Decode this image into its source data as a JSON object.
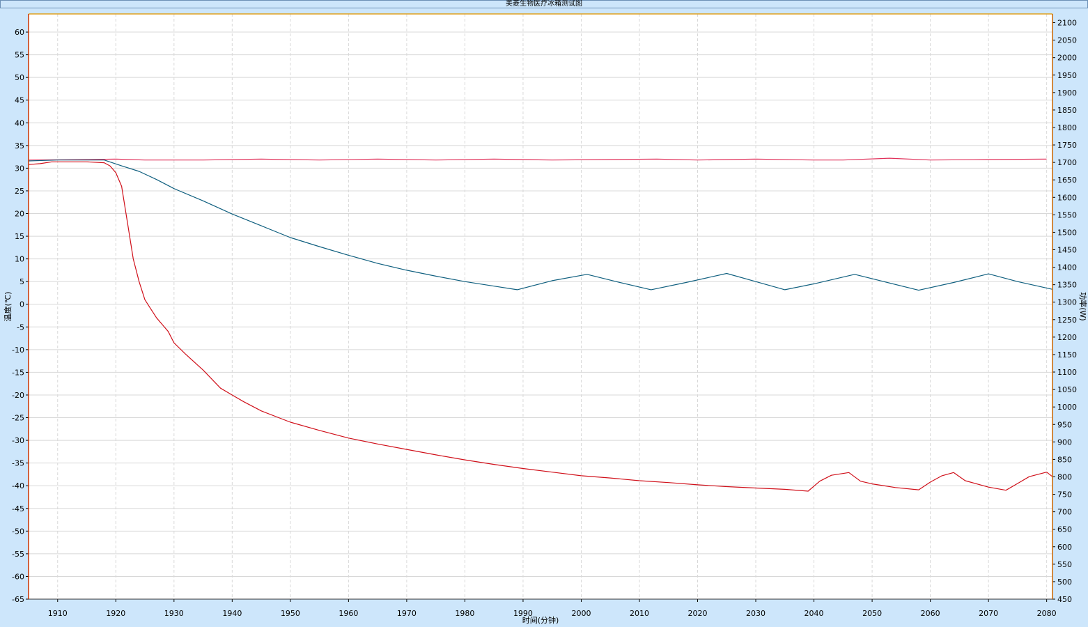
{
  "window": {
    "title": "美菱生物医疗冰箱测试图"
  },
  "colors": {
    "background": "#cde6fb",
    "plot_background": "#ffffff",
    "grid": "#d8d8d8",
    "axis_left": "#cc3300",
    "axis_right": "#cc6600",
    "top_border": "#e0a020"
  },
  "chart_data": {
    "type": "line",
    "title": "美菱生物医疗冰箱测试图",
    "xlabel": "时间(分钟)",
    "ylabel": "温度(℃)",
    "y2label": "功率(W)",
    "xlim": [
      1905,
      2081
    ],
    "ylim": [
      -65,
      64
    ],
    "y2lim": [
      450,
      2125
    ],
    "grid": true,
    "x_ticks": [
      1910,
      1920,
      1930,
      1940,
      1950,
      1960,
      1970,
      1980,
      1990,
      2000,
      2010,
      2020,
      2030,
      2040,
      2050,
      2060,
      2070,
      2080
    ],
    "y_ticks": [
      60,
      55,
      50,
      45,
      40,
      35,
      30,
      25,
      20,
      15,
      10,
      5,
      0,
      -5,
      -10,
      -15,
      -20,
      -25,
      -30,
      -35,
      -40,
      -45,
      -50,
      -55,
      -60,
      -65
    ],
    "y2_ticks": [
      2100,
      2050,
      2000,
      1950,
      1900,
      1850,
      1800,
      1750,
      1700,
      1650,
      1600,
      1550,
      1500,
      1450,
      1400,
      1350,
      1300,
      1250,
      1200,
      1150,
      1100,
      1050,
      1000,
      950,
      900,
      850,
      800,
      750,
      700,
      650,
      600,
      550,
      500,
      450
    ],
    "series": [
      {
        "color": "#e0305a",
        "points": [
          [
            1905,
            31.8
          ],
          [
            1915,
            31.9
          ],
          [
            1920,
            32.0
          ],
          [
            1925,
            31.8
          ],
          [
            1935,
            31.8
          ],
          [
            1945,
            32.0
          ],
          [
            1955,
            31.8
          ],
          [
            1965,
            32.0
          ],
          [
            1975,
            31.8
          ],
          [
            1985,
            32.0
          ],
          [
            1995,
            31.8
          ],
          [
            2005,
            31.9
          ],
          [
            2013,
            32.0
          ],
          [
            2020,
            31.8
          ],
          [
            2030,
            32.0
          ],
          [
            2040,
            31.8
          ],
          [
            2045,
            31.8
          ],
          [
            2053,
            32.2
          ],
          [
            2060,
            31.8
          ],
          [
            2070,
            31.9
          ],
          [
            2080,
            32.0
          ]
        ]
      },
      {
        "color": "#0f5f7f",
        "points": [
          [
            1905,
            31.6
          ],
          [
            1910,
            31.8
          ],
          [
            1918,
            31.8
          ],
          [
            1921,
            30.5
          ],
          [
            1924,
            29.3
          ],
          [
            1927,
            27.5
          ],
          [
            1930,
            25.5
          ],
          [
            1935,
            22.8
          ],
          [
            1940,
            19.9
          ],
          [
            1945,
            17.3
          ],
          [
            1950,
            14.7
          ],
          [
            1955,
            12.7
          ],
          [
            1960,
            10.8
          ],
          [
            1965,
            9.0
          ],
          [
            1970,
            7.5
          ],
          [
            1975,
            6.2
          ],
          [
            1980,
            5.0
          ],
          [
            1985,
            4.0
          ],
          [
            1989,
            3.2
          ],
          [
            1995,
            5.2
          ],
          [
            2001,
            6.6
          ],
          [
            2006,
            5.0
          ],
          [
            2012,
            3.2
          ],
          [
            2018,
            4.8
          ],
          [
            2025,
            6.8
          ],
          [
            2030,
            5.0
          ],
          [
            2035,
            3.2
          ],
          [
            2040,
            4.5
          ],
          [
            2047,
            6.6
          ],
          [
            2052,
            5.0
          ],
          [
            2058,
            3.1
          ],
          [
            2064,
            4.8
          ],
          [
            2070,
            6.7
          ],
          [
            2075,
            5.0
          ],
          [
            2081,
            3.3
          ]
        ]
      },
      {
        "color": "#d0101a",
        "points": [
          [
            1905,
            30.8
          ],
          [
            1907,
            31.0
          ],
          [
            1909,
            31.4
          ],
          [
            1915,
            31.4
          ],
          [
            1918,
            31.2
          ],
          [
            1919,
            30.5
          ],
          [
            1920,
            29.0
          ],
          [
            1921,
            26.0
          ],
          [
            1922,
            18.0
          ],
          [
            1923,
            10.0
          ],
          [
            1924,
            5.0
          ],
          [
            1925,
            1.0
          ],
          [
            1926,
            -1.0
          ],
          [
            1927,
            -3.0
          ],
          [
            1928,
            -4.5
          ],
          [
            1929,
            -6.0
          ],
          [
            1930,
            -8.5
          ],
          [
            1932,
            -11.0
          ],
          [
            1935,
            -14.5
          ],
          [
            1938,
            -18.5
          ],
          [
            1940,
            -20.0
          ],
          [
            1942,
            -21.5
          ],
          [
            1945,
            -23.5
          ],
          [
            1950,
            -26.0
          ],
          [
            1955,
            -27.8
          ],
          [
            1960,
            -29.5
          ],
          [
            1965,
            -30.8
          ],
          [
            1970,
            -32.0
          ],
          [
            1975,
            -33.2
          ],
          [
            1980,
            -34.3
          ],
          [
            1985,
            -35.3
          ],
          [
            1990,
            -36.2
          ],
          [
            1995,
            -37.0
          ],
          [
            2000,
            -37.8
          ],
          [
            2005,
            -38.3
          ],
          [
            2010,
            -38.9
          ],
          [
            2015,
            -39.3
          ],
          [
            2020,
            -39.8
          ],
          [
            2025,
            -40.2
          ],
          [
            2030,
            -40.5
          ],
          [
            2035,
            -40.8
          ],
          [
            2039,
            -41.2
          ],
          [
            2041,
            -39.0
          ],
          [
            2043,
            -37.7
          ],
          [
            2046,
            -37.1
          ],
          [
            2048,
            -39.0
          ],
          [
            2050,
            -39.6
          ],
          [
            2054,
            -40.4
          ],
          [
            2058,
            -40.9
          ],
          [
            2060,
            -39.2
          ],
          [
            2062,
            -37.8
          ],
          [
            2064,
            -37.1
          ],
          [
            2066,
            -38.9
          ],
          [
            2070,
            -40.3
          ],
          [
            2073,
            -41.0
          ],
          [
            2075,
            -39.5
          ],
          [
            2077,
            -38.0
          ],
          [
            2080,
            -37.0
          ],
          [
            2081,
            -38.0
          ]
        ]
      }
    ]
  }
}
